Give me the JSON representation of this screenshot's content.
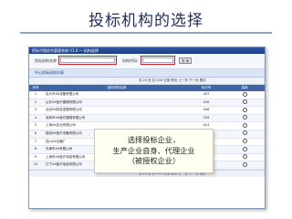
{
  "slide": {
    "title": "投标机构的选择"
  },
  "window": {
    "title": "招标代理综合管理系统 V1.0 — 机构选择"
  },
  "search": {
    "org_name_label": "投标机构名称：",
    "org_name_value": "",
    "org_code_label": "机构代码：",
    "org_code_value": "",
    "query_button": "查 询"
  },
  "section": {
    "title": "中心投标机构列表"
  },
  "pager": {
    "top": "共 20 页  共 200 记录  首页 上一页 下一页 尾页",
    "bottom": "共 20 页  共 200 记录  首页 上一页 下一页 尾页"
  },
  "grid": {
    "headers": {
      "no": "序号",
      "name": "投标机构名称",
      "code": "标识号",
      "pick": "选择"
    },
    "rows": [
      {
        "no": "1",
        "name": "包头市XX设备有限公司",
        "code": "007"
      },
      {
        "no": "2",
        "name": "山东XX医疗器械有限公司",
        "code": "030"
      },
      {
        "no": "3",
        "name": "北京XX科技发展有限公司",
        "code": "008"
      },
      {
        "no": "4",
        "name": "深圳市XX医疗器械有限公司",
        "code": "035"
      },
      {
        "no": "5",
        "name": "上海XX实业有限公司",
        "code": "024"
      },
      {
        "no": "6",
        "name": "陕西XX医疗设备有限公司",
        "code": "012"
      },
      {
        "no": "7",
        "name": "四川XX仪器厂",
        "code": "019"
      },
      {
        "no": "8",
        "name": "天津市XX有限公司",
        "code": "021"
      },
      {
        "no": "9",
        "name": "上海市XX医疗科技有限公司",
        "code": "016"
      },
      {
        "no": "10",
        "name": "辽宁XX医疗用品有限公司",
        "code": "027"
      }
    ]
  },
  "callout": {
    "line1": "选择投标企业，",
    "line2": "生产企业自身、代理企业",
    "line3": "（被授权企业）"
  },
  "colors": {
    "highlight": "#d42020",
    "grid_header": "#3f64a8",
    "title": "#1f2e5c"
  }
}
